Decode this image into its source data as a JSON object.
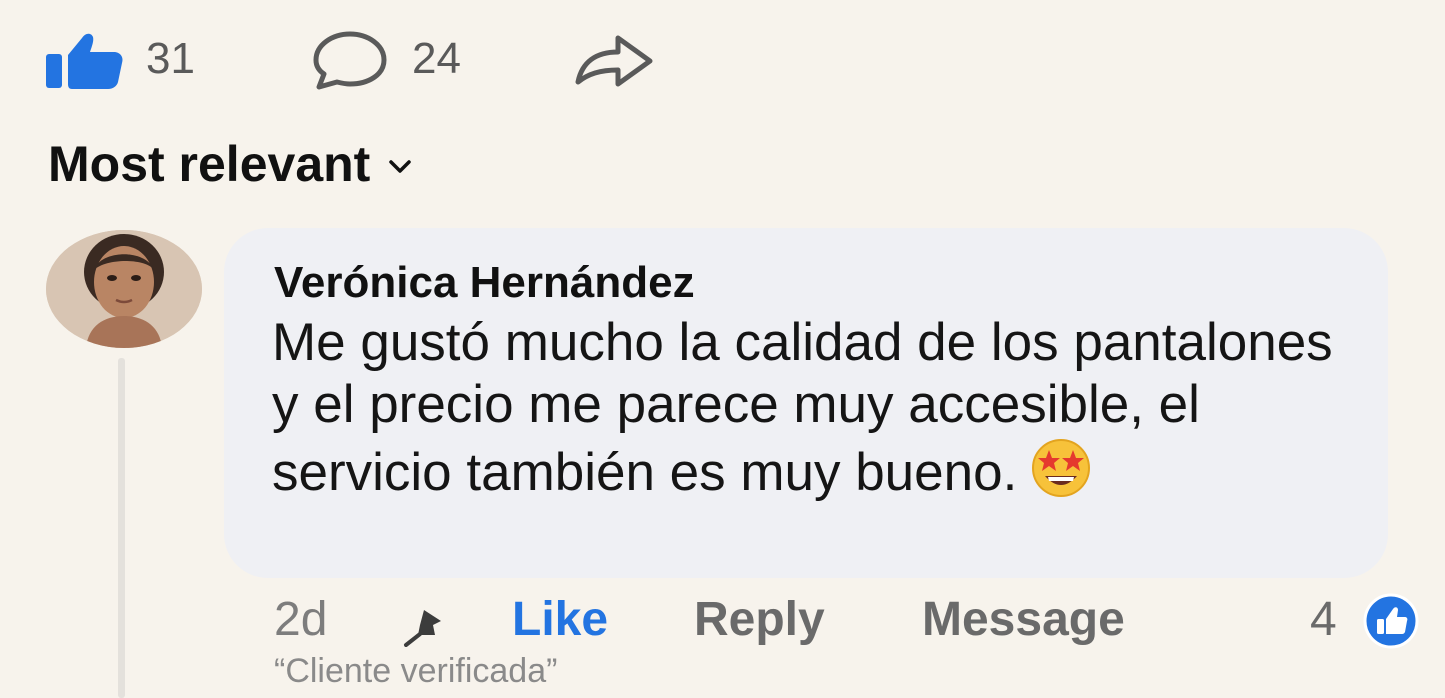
{
  "stats": {
    "likes": "31",
    "comments": "24",
    "like_icon": "thumbs-up-icon",
    "comment_icon": "speech-bubble-icon",
    "share_icon": "share-arrow-icon",
    "accent": "#2374e1"
  },
  "sort": {
    "label": "Most relevant",
    "icon": "chevron-down-icon"
  },
  "comment": {
    "author": "Verónica Hernández",
    "text": "Me gustó mucho la calidad de los pantalones y el precio me parece muy accesible, el servicio también es muy bueno.",
    "emoji": "star-struck-emoji",
    "time": "2d",
    "pin_icon": "pin-icon",
    "like_label": "Like",
    "reply_label": "Reply",
    "message_label": "Message",
    "reaction_count": "4",
    "reaction_icon": "like-reaction-icon",
    "note": "“Cliente verificada”"
  }
}
